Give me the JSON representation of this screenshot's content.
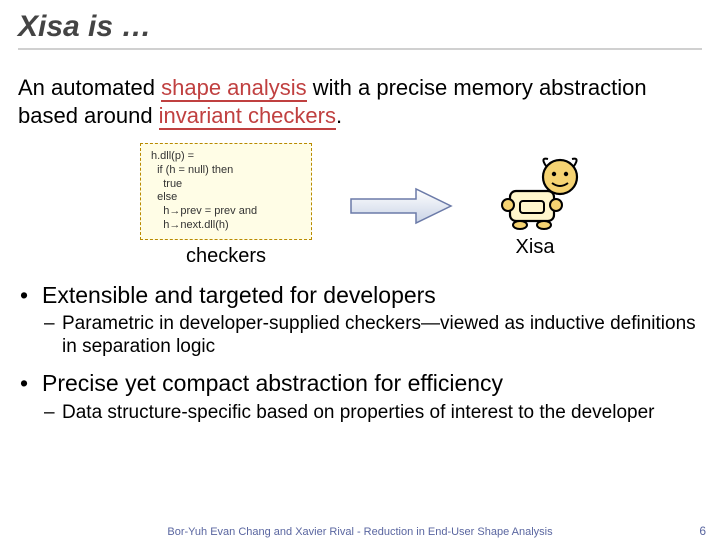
{
  "title": "Xisa is …",
  "intro": {
    "pre": "An automated ",
    "hl1": "shape analysis",
    "mid": " with a precise memory abstraction based around ",
    "hl2": "invariant checkers",
    "post": "."
  },
  "code": "h.dll(p) =\n  if (h = null) then\n    true\n  else\n    h→prev = prev and\n    h→next.dll(h)",
  "captions": {
    "checkers": "checkers",
    "xisa": "Xisa"
  },
  "bullets": [
    {
      "text": "Extensible and targeted for developers",
      "sub": [
        "Parametric in developer-supplied checkers—viewed as inductive definitions in separation logic"
      ]
    },
    {
      "text": "Precise yet compact abstraction for efficiency",
      "sub": [
        "Data structure-specific based on properties of interest to the developer"
      ]
    }
  ],
  "footer": "Bor-Yuh Evan Chang and Xavier Rival - Reduction in End-User Shape Analysis",
  "page": "6"
}
